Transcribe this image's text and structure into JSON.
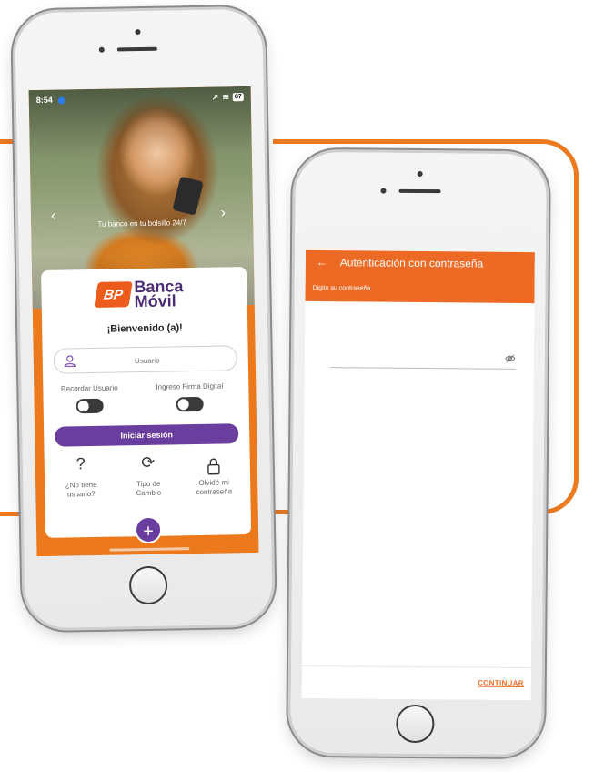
{
  "phone1": {
    "status": {
      "time": "8:54",
      "battery": "87"
    },
    "carousel_caption": "Tu banco en tu bolsillo 24/7",
    "logo": {
      "mark": "BP",
      "line1": "Banca",
      "line2": "Móvil"
    },
    "welcome": "¡Bienvenido (a)!",
    "username_placeholder": "Usuario",
    "toggle_remember_label": "Recordar Usuario",
    "toggle_signature_label": "Ingreso Firma Digital",
    "login_label": "Iniciar sesión",
    "quick_actions": [
      {
        "icon": "question-icon",
        "line1": "¿No tiene",
        "line2": "usuario?"
      },
      {
        "icon": "refresh-icon",
        "line1": "Tipo de",
        "line2": "Cambio"
      },
      {
        "icon": "lock-icon",
        "line1": "Olvidé mi",
        "line2": "contraseña"
      }
    ],
    "fab_label": "+"
  },
  "phone2": {
    "header_title": "Autenticación con contraseña",
    "header_subtitle": "Digite su contraseña",
    "password_value": "",
    "continue_label": "CONTINUAR"
  },
  "colors": {
    "orange": "#ed6a24",
    "purple": "#6a3e9e",
    "accent_frame": "#ee7a1f"
  }
}
